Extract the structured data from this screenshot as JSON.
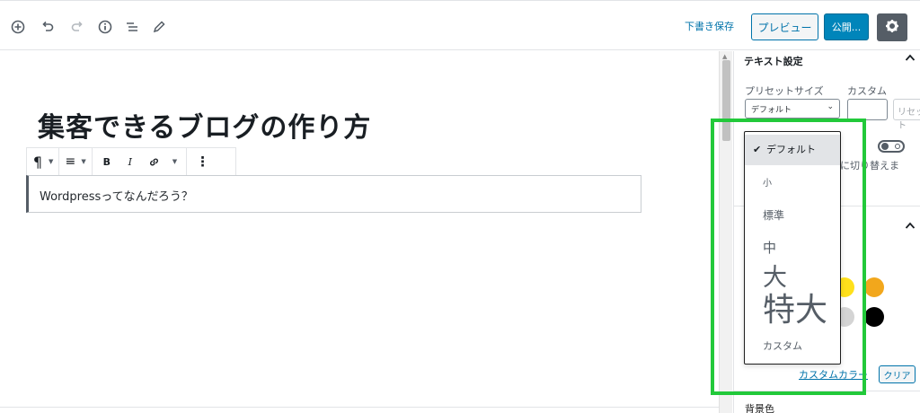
{
  "toolbar": {
    "add_block_icon": "plus-circle-icon",
    "undo_icon": "undo-icon",
    "redo_icon": "redo-icon",
    "info_icon": "info-icon",
    "outline_icon": "list-icon",
    "tools_icon": "pencil-icon",
    "draft_label": "下書き保存",
    "preview_label": "プレビュー",
    "publish_label": "公開...",
    "settings_icon": "gear-icon"
  },
  "editor": {
    "post_title": "集客できるブログの作り方",
    "block_toolbar": {
      "paragraph_icon": "¶",
      "align_icon": "≡",
      "bold": "B",
      "italic": "I",
      "link_icon": "link-icon",
      "more_icon": "⋮"
    },
    "paragraph_text": "Wordpressってなんだろう？"
  },
  "sidebar": {
    "text_settings_title": "テキスト設定",
    "preset_size_label": "プリセットサイズ",
    "custom_label": "カスタム",
    "preset_selected": "デフォルト",
    "reset_label": "リセット",
    "toggle_text": "に切り替えま",
    "custom_color_label": "カスタムカラー",
    "clear_label": "クリア",
    "background_color_label": "背景色",
    "colors": {
      "yellow": "#ffe01b",
      "orange": "#f2a71c",
      "gray": "#d4d4d4",
      "black": "#000000"
    }
  },
  "dropdown": {
    "options": [
      "デフォルト",
      "小",
      "標準",
      "中",
      "大",
      "特大",
      "カスタム"
    ],
    "selected_index": 0
  },
  "colors": {
    "accent": "#0085ba",
    "link": "#0073aa",
    "highlight": "#22c93a"
  }
}
